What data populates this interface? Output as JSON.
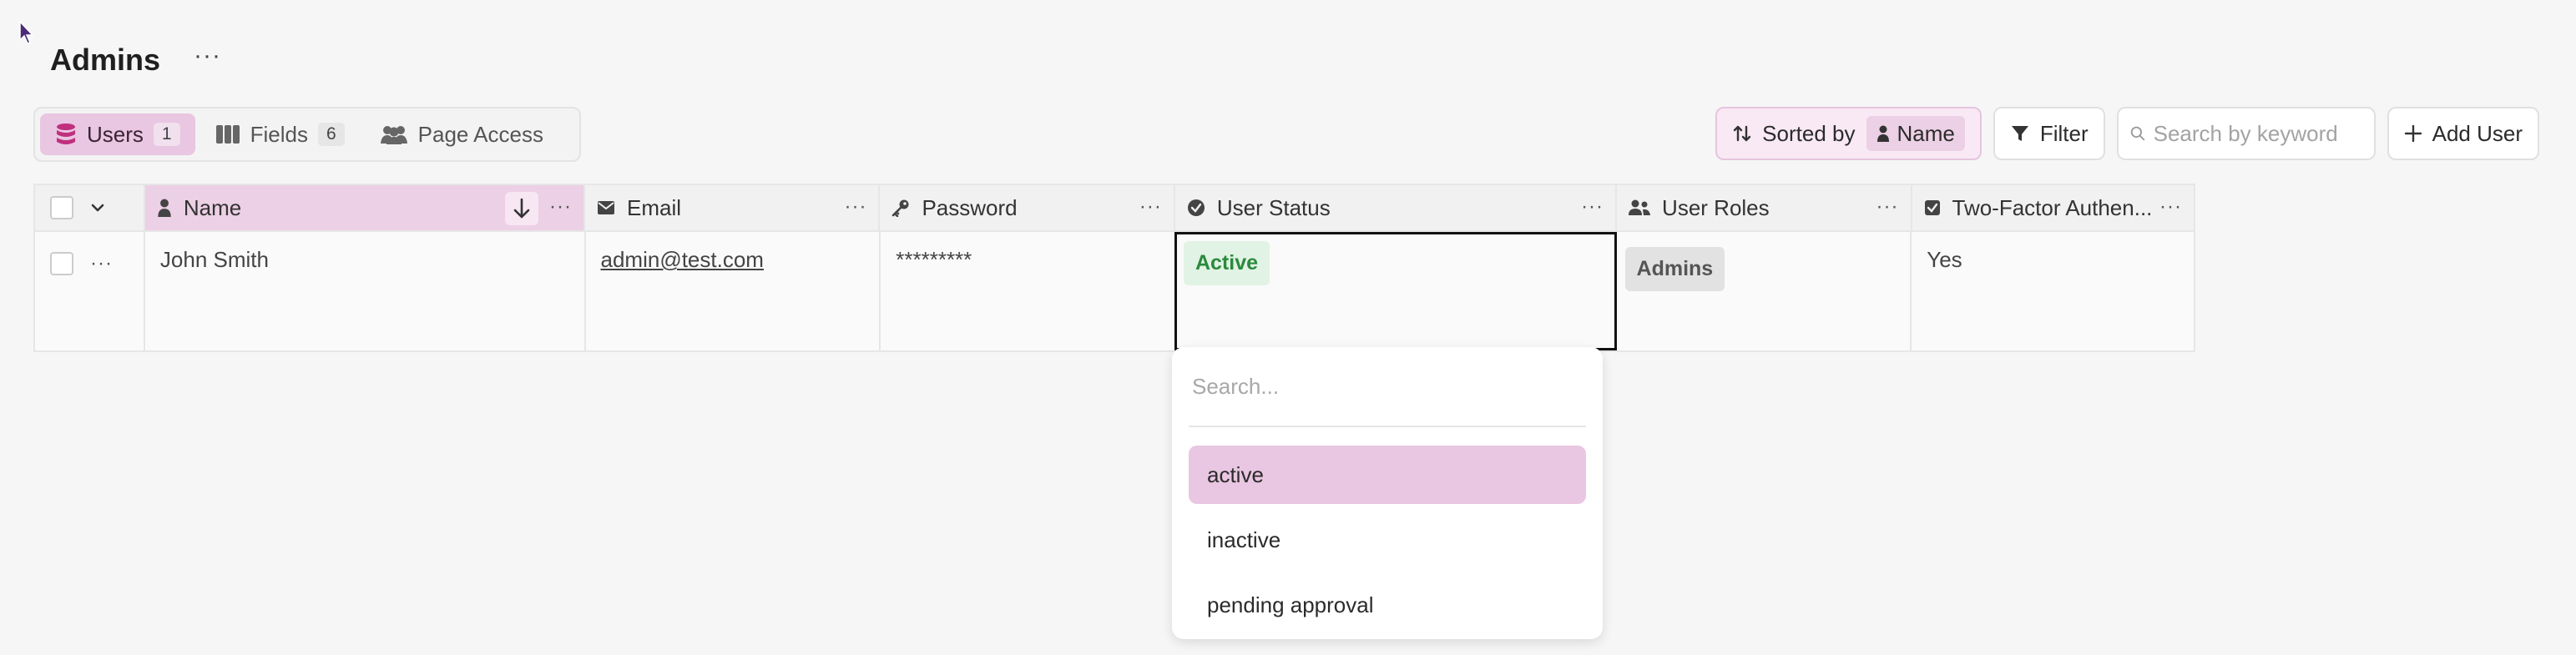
{
  "page": {
    "title": "Admins",
    "menu_label": "···"
  },
  "view_tabs": [
    {
      "label": "Users",
      "count": "1",
      "icon": "database-icon"
    },
    {
      "label": "Fields",
      "count": "6",
      "icon": "columns-icon"
    },
    {
      "label": "Page Access",
      "icon": "users-icon"
    }
  ],
  "toolbar": {
    "sorted_by_label": "Sorted by",
    "sorted_field": "Name",
    "filter_label": "Filter",
    "search_placeholder": "Search by keyword",
    "add_user_label": "Add User"
  },
  "table": {
    "columns": [
      {
        "label": "Name",
        "icon": "person-icon"
      },
      {
        "label": "Email",
        "icon": "envelope-icon"
      },
      {
        "label": "Password",
        "icon": "key-icon"
      },
      {
        "label": "User Status",
        "icon": "status-circle-icon"
      },
      {
        "label": "User Roles",
        "icon": "user-group-icon"
      },
      {
        "label": "Two-Factor Authen...",
        "icon": "checkbox-icon"
      }
    ],
    "header_more": "···",
    "rows": [
      {
        "name": "John Smith",
        "email": "admin@test.com",
        "password": "*********",
        "status": "Active",
        "roles": "Admins",
        "two_factor": "Yes",
        "row_more": "···"
      }
    ]
  },
  "status_dropdown": {
    "search_placeholder": "Search...",
    "options": [
      "active",
      "inactive",
      "pending approval"
    ],
    "highlighted": "active"
  },
  "colors": {
    "accent_pink": "#e9c6e1",
    "status_active_bg": "#e1f3e4",
    "status_active_text": "#2a8a3c"
  }
}
